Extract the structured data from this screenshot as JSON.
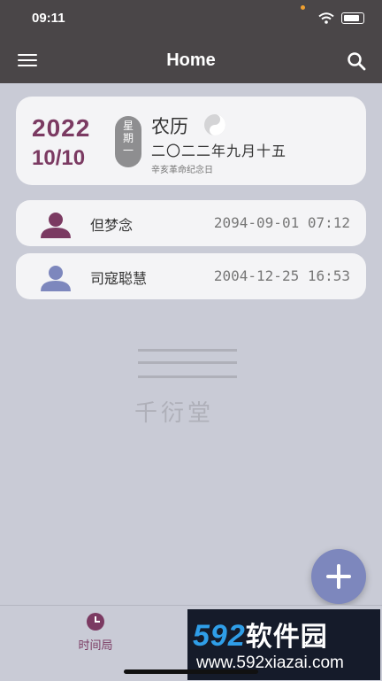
{
  "status_bar": {
    "time": "09:11"
  },
  "navbar": {
    "title": "Home"
  },
  "date_card": {
    "year": "2022",
    "month_day": "10/10",
    "weekday": [
      "星",
      "期",
      "一"
    ],
    "lunar_label": "农历",
    "lunar_date": "二〇二二年九月十五",
    "festival": "辛亥革命纪念日"
  },
  "contacts": [
    {
      "name": "但梦念",
      "time": "2094-09-01 07:12",
      "avatar_color": "#7b3a62"
    },
    {
      "name": "司寇聪慧",
      "time": "2004-12-25 16:53",
      "avatar_color": "#7d87bd"
    }
  ],
  "watermark": {
    "text": "千衍堂"
  },
  "tabbar": {
    "tab1_label": "时间局"
  },
  "brand_overlay": {
    "number": "592",
    "name": "软件园",
    "url": "www.592xiazai.com"
  },
  "colors": {
    "accent": "#7b3a62",
    "fab": "#7d87bd",
    "bar": "#4a4648",
    "background": "#c9cbd6"
  }
}
